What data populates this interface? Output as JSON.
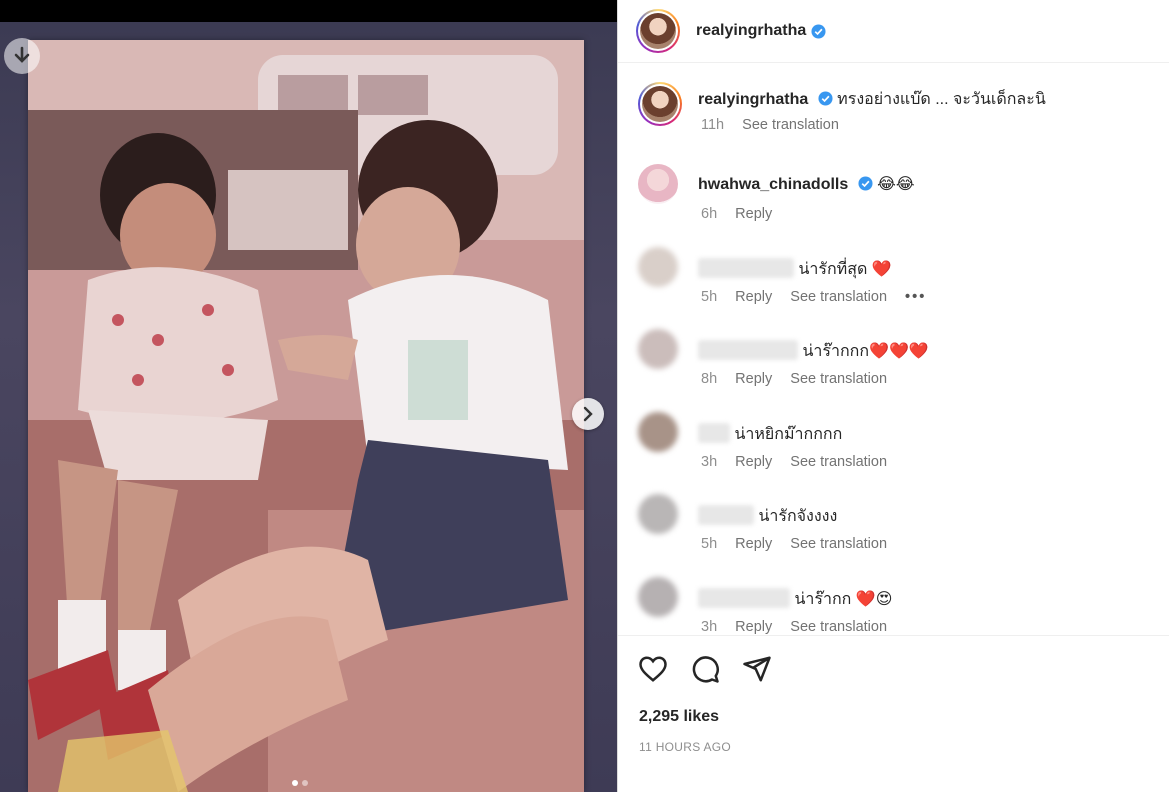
{
  "post": {
    "author": "realyingrhatha",
    "caption": "ทรงอย่างแบ๊ด ... จะวันเด็กละนิ",
    "time": "11h",
    "see_translation": "See translation",
    "likes": "2,295 likes",
    "time_ago": "11 HOURS AGO"
  },
  "media": {
    "current_slide": 1,
    "total_slides": 2
  },
  "comments": [
    {
      "user": "hwahwa_chinadolls",
      "verified": true,
      "text": "😂😂",
      "time": "6h",
      "reply": "Reply"
    },
    {
      "user": "",
      "text": "น่ารักที่สุด ❤️",
      "time": "5h",
      "reply": "Reply",
      "translate": "See translation",
      "more": "•••"
    },
    {
      "user": "",
      "text": "น่าร๊ากกก❤️❤️❤️",
      "time": "8h",
      "reply": "Reply",
      "translate": "See translation"
    },
    {
      "user": "",
      "text": "น่าหยิกม๊ากกกก",
      "time": "3h",
      "reply": "Reply",
      "translate": "See translation"
    },
    {
      "user": "",
      "text": "น่ารักจังงงง",
      "time": "5h",
      "reply": "Reply",
      "translate": "See translation"
    },
    {
      "user": "",
      "text": "น่าร๊ากก ❤️😍",
      "time": "3h",
      "reply": "Reply",
      "translate": "See translation"
    }
  ],
  "icons": [
    "download-icon",
    "chevron-right-icon",
    "verified-badge-icon",
    "heart-icon",
    "comment-icon",
    "share-icon"
  ],
  "colors": {
    "verified": "#3897f0",
    "border": "#dbdbdb",
    "muted": "#8e8e8e"
  }
}
